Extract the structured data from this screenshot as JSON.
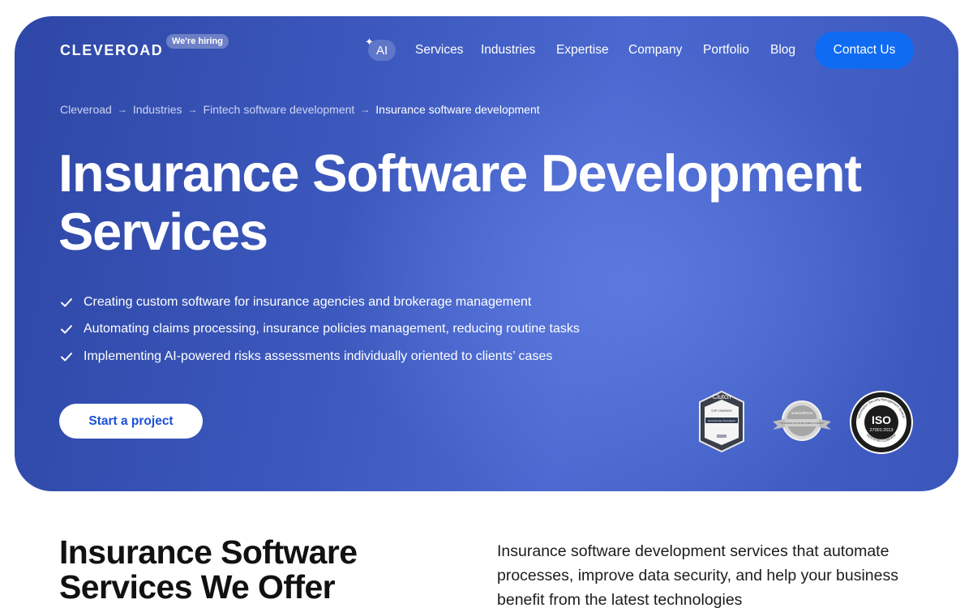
{
  "header": {
    "logo": "CLEVEROAD",
    "hiring_badge": "We're hiring",
    "ai_label": "AI",
    "nav": [
      "Services",
      "Industries",
      "Expertise",
      "Company",
      "Portfolio",
      "Blog"
    ],
    "contact_label": "Contact Us"
  },
  "breadcrumb": [
    "Cleveroad",
    "Industries",
    "Fintech software development",
    "Insurance software development"
  ],
  "hero": {
    "title": "Insurance Software Development Services",
    "features": [
      "Creating custom software for insurance agencies and brokerage management",
      "Automating claims processing, insurance policies management, reducing routine tasks",
      "Implementing AI-powered risks assessments individually oriented to clients’ cases"
    ],
    "cta_label": "Start a project"
  },
  "badges": {
    "clutch_name": "Clutch",
    "clutch_line1": "TOP COMPANY",
    "clutch_line2": "Financial App Developers",
    "selected_name": "SelectedFirms",
    "selected_line": "TOP MOBILE APP DEVELOPMENT COMPANY",
    "iso_code": "ISO",
    "iso_number": "27001:2013",
    "iso_ring_top": "Information Security Management System",
    "iso_ring_bottom": "CERTIFIED COMPANY"
  },
  "section": {
    "title": "Insurance Software Services We Offer",
    "description": "Insurance software development services that automate processes, improve data security, and help your business benefit from the latest technologies"
  },
  "colors": {
    "hero_blue": "#3c58bd",
    "accent_button": "#0f6bf2",
    "cta_text": "#1a4fd6"
  }
}
